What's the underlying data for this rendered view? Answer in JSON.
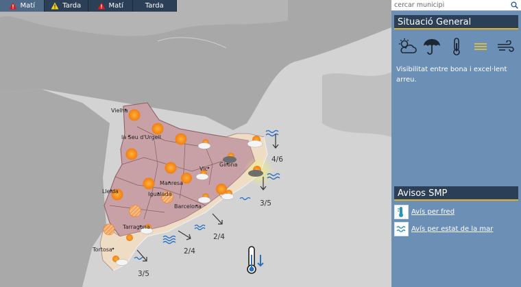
{
  "tabs": [
    {
      "label": "Matí",
      "warning": true,
      "active": true
    },
    {
      "label": "Tarda",
      "warning": true,
      "warning_color": "#f2d21b",
      "active": false
    },
    {
      "label": "Matí",
      "warning": true,
      "active": false
    },
    {
      "label": "Tarda",
      "warning": false,
      "active": false
    }
  ],
  "search": {
    "placeholder": "cercar municipi",
    "icon": "search-icon"
  },
  "situacio": {
    "title": "Situació General",
    "icons": [
      "cloud-sun-icon",
      "umbrella-icon",
      "thermometer-icon",
      "fog-lines-icon",
      "wind-icon"
    ],
    "text": "Visibilitat entre bona i excel·lent arreu."
  },
  "avisos": {
    "title": "Avisos SMP",
    "items": [
      {
        "label": "Avís per fred",
        "icon": "thermometer-cold-icon"
      },
      {
        "label": "Avís per estat de la mar",
        "icon": "waves-icon"
      }
    ]
  },
  "map": {
    "cities": [
      "Vielha",
      "la Seu d'Urgell",
      "Vic",
      "Girona",
      "Manresa",
      "Lleida",
      "Igualada",
      "Barcelona",
      "Tarragona",
      "Tortosa"
    ],
    "sea_states": [
      "4/6",
      "3/5",
      "2/4",
      "2/4",
      "3/5"
    ],
    "colors": {
      "cold_warning_region": "#c9a0a6",
      "mild_region": "#efdcc5",
      "sea": "#d0d0d0",
      "land": "#a6a6a6"
    }
  }
}
